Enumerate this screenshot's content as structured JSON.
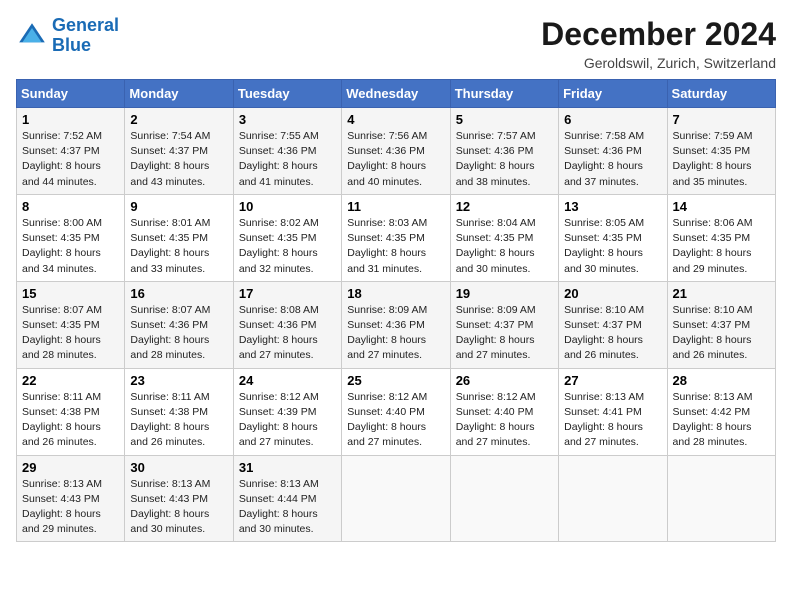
{
  "logo": {
    "line1": "General",
    "line2": "Blue"
  },
  "title": "December 2024",
  "location": "Geroldswil, Zurich, Switzerland",
  "days_of_week": [
    "Sunday",
    "Monday",
    "Tuesday",
    "Wednesday",
    "Thursday",
    "Friday",
    "Saturday"
  ],
  "weeks": [
    [
      {
        "day": "1",
        "sunrise": "7:52 AM",
        "sunset": "4:37 PM",
        "daylight": "8 hours and 44 minutes."
      },
      {
        "day": "2",
        "sunrise": "7:54 AM",
        "sunset": "4:37 PM",
        "daylight": "8 hours and 43 minutes."
      },
      {
        "day": "3",
        "sunrise": "7:55 AM",
        "sunset": "4:36 PM",
        "daylight": "8 hours and 41 minutes."
      },
      {
        "day": "4",
        "sunrise": "7:56 AM",
        "sunset": "4:36 PM",
        "daylight": "8 hours and 40 minutes."
      },
      {
        "day": "5",
        "sunrise": "7:57 AM",
        "sunset": "4:36 PM",
        "daylight": "8 hours and 38 minutes."
      },
      {
        "day": "6",
        "sunrise": "7:58 AM",
        "sunset": "4:36 PM",
        "daylight": "8 hours and 37 minutes."
      },
      {
        "day": "7",
        "sunrise": "7:59 AM",
        "sunset": "4:35 PM",
        "daylight": "8 hours and 35 minutes."
      }
    ],
    [
      {
        "day": "8",
        "sunrise": "8:00 AM",
        "sunset": "4:35 PM",
        "daylight": "8 hours and 34 minutes."
      },
      {
        "day": "9",
        "sunrise": "8:01 AM",
        "sunset": "4:35 PM",
        "daylight": "8 hours and 33 minutes."
      },
      {
        "day": "10",
        "sunrise": "8:02 AM",
        "sunset": "4:35 PM",
        "daylight": "8 hours and 32 minutes."
      },
      {
        "day": "11",
        "sunrise": "8:03 AM",
        "sunset": "4:35 PM",
        "daylight": "8 hours and 31 minutes."
      },
      {
        "day": "12",
        "sunrise": "8:04 AM",
        "sunset": "4:35 PM",
        "daylight": "8 hours and 30 minutes."
      },
      {
        "day": "13",
        "sunrise": "8:05 AM",
        "sunset": "4:35 PM",
        "daylight": "8 hours and 30 minutes."
      },
      {
        "day": "14",
        "sunrise": "8:06 AM",
        "sunset": "4:35 PM",
        "daylight": "8 hours and 29 minutes."
      }
    ],
    [
      {
        "day": "15",
        "sunrise": "8:07 AM",
        "sunset": "4:35 PM",
        "daylight": "8 hours and 28 minutes."
      },
      {
        "day": "16",
        "sunrise": "8:07 AM",
        "sunset": "4:36 PM",
        "daylight": "8 hours and 28 minutes."
      },
      {
        "day": "17",
        "sunrise": "8:08 AM",
        "sunset": "4:36 PM",
        "daylight": "8 hours and 27 minutes."
      },
      {
        "day": "18",
        "sunrise": "8:09 AM",
        "sunset": "4:36 PM",
        "daylight": "8 hours and 27 minutes."
      },
      {
        "day": "19",
        "sunrise": "8:09 AM",
        "sunset": "4:37 PM",
        "daylight": "8 hours and 27 minutes."
      },
      {
        "day": "20",
        "sunrise": "8:10 AM",
        "sunset": "4:37 PM",
        "daylight": "8 hours and 26 minutes."
      },
      {
        "day": "21",
        "sunrise": "8:10 AM",
        "sunset": "4:37 PM",
        "daylight": "8 hours and 26 minutes."
      }
    ],
    [
      {
        "day": "22",
        "sunrise": "8:11 AM",
        "sunset": "4:38 PM",
        "daylight": "8 hours and 26 minutes."
      },
      {
        "day": "23",
        "sunrise": "8:11 AM",
        "sunset": "4:38 PM",
        "daylight": "8 hours and 26 minutes."
      },
      {
        "day": "24",
        "sunrise": "8:12 AM",
        "sunset": "4:39 PM",
        "daylight": "8 hours and 27 minutes."
      },
      {
        "day": "25",
        "sunrise": "8:12 AM",
        "sunset": "4:40 PM",
        "daylight": "8 hours and 27 minutes."
      },
      {
        "day": "26",
        "sunrise": "8:12 AM",
        "sunset": "4:40 PM",
        "daylight": "8 hours and 27 minutes."
      },
      {
        "day": "27",
        "sunrise": "8:13 AM",
        "sunset": "4:41 PM",
        "daylight": "8 hours and 27 minutes."
      },
      {
        "day": "28",
        "sunrise": "8:13 AM",
        "sunset": "4:42 PM",
        "daylight": "8 hours and 28 minutes."
      }
    ],
    [
      {
        "day": "29",
        "sunrise": "8:13 AM",
        "sunset": "4:43 PM",
        "daylight": "8 hours and 29 minutes."
      },
      {
        "day": "30",
        "sunrise": "8:13 AM",
        "sunset": "4:43 PM",
        "daylight": "8 hours and 30 minutes."
      },
      {
        "day": "31",
        "sunrise": "8:13 AM",
        "sunset": "4:44 PM",
        "daylight": "8 hours and 30 minutes."
      },
      null,
      null,
      null,
      null
    ]
  ]
}
